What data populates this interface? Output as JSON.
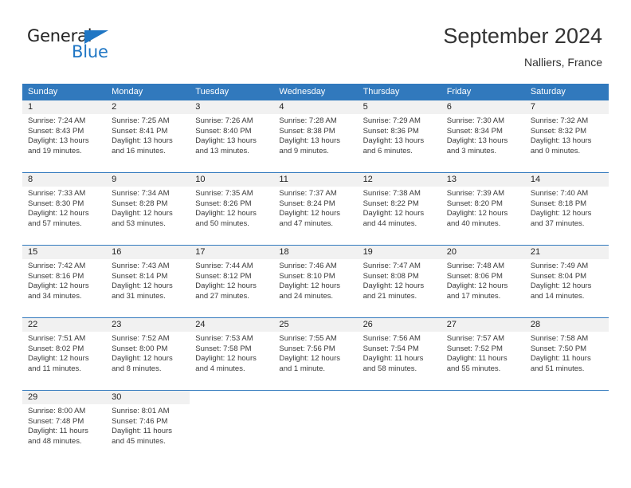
{
  "brand": {
    "name_part1": "General",
    "name_part2": "Blue",
    "triangle_color": "#1f76c4"
  },
  "header": {
    "title": "September 2024",
    "subtitle": "Nalliers, France"
  },
  "colors": {
    "header_blue": "#3179bd",
    "daynum_band": "#f1f1f1",
    "text": "#3a3a3a"
  },
  "weekday_headers": [
    "Sunday",
    "Monday",
    "Tuesday",
    "Wednesday",
    "Thursday",
    "Friday",
    "Saturday"
  ],
  "weeks": [
    [
      {
        "day": "1",
        "sunrise": "Sunrise: 7:24 AM",
        "sunset": "Sunset: 8:43 PM",
        "daylight1": "Daylight: 13 hours",
        "daylight2": "and 19 minutes."
      },
      {
        "day": "2",
        "sunrise": "Sunrise: 7:25 AM",
        "sunset": "Sunset: 8:41 PM",
        "daylight1": "Daylight: 13 hours",
        "daylight2": "and 16 minutes."
      },
      {
        "day": "3",
        "sunrise": "Sunrise: 7:26 AM",
        "sunset": "Sunset: 8:40 PM",
        "daylight1": "Daylight: 13 hours",
        "daylight2": "and 13 minutes."
      },
      {
        "day": "4",
        "sunrise": "Sunrise: 7:28 AM",
        "sunset": "Sunset: 8:38 PM",
        "daylight1": "Daylight: 13 hours",
        "daylight2": "and 9 minutes."
      },
      {
        "day": "5",
        "sunrise": "Sunrise: 7:29 AM",
        "sunset": "Sunset: 8:36 PM",
        "daylight1": "Daylight: 13 hours",
        "daylight2": "and 6 minutes."
      },
      {
        "day": "6",
        "sunrise": "Sunrise: 7:30 AM",
        "sunset": "Sunset: 8:34 PM",
        "daylight1": "Daylight: 13 hours",
        "daylight2": "and 3 minutes."
      },
      {
        "day": "7",
        "sunrise": "Sunrise: 7:32 AM",
        "sunset": "Sunset: 8:32 PM",
        "daylight1": "Daylight: 13 hours",
        "daylight2": "and 0 minutes."
      }
    ],
    [
      {
        "day": "8",
        "sunrise": "Sunrise: 7:33 AM",
        "sunset": "Sunset: 8:30 PM",
        "daylight1": "Daylight: 12 hours",
        "daylight2": "and 57 minutes."
      },
      {
        "day": "9",
        "sunrise": "Sunrise: 7:34 AM",
        "sunset": "Sunset: 8:28 PM",
        "daylight1": "Daylight: 12 hours",
        "daylight2": "and 53 minutes."
      },
      {
        "day": "10",
        "sunrise": "Sunrise: 7:35 AM",
        "sunset": "Sunset: 8:26 PM",
        "daylight1": "Daylight: 12 hours",
        "daylight2": "and 50 minutes."
      },
      {
        "day": "11",
        "sunrise": "Sunrise: 7:37 AM",
        "sunset": "Sunset: 8:24 PM",
        "daylight1": "Daylight: 12 hours",
        "daylight2": "and 47 minutes."
      },
      {
        "day": "12",
        "sunrise": "Sunrise: 7:38 AM",
        "sunset": "Sunset: 8:22 PM",
        "daylight1": "Daylight: 12 hours",
        "daylight2": "and 44 minutes."
      },
      {
        "day": "13",
        "sunrise": "Sunrise: 7:39 AM",
        "sunset": "Sunset: 8:20 PM",
        "daylight1": "Daylight: 12 hours",
        "daylight2": "and 40 minutes."
      },
      {
        "day": "14",
        "sunrise": "Sunrise: 7:40 AM",
        "sunset": "Sunset: 8:18 PM",
        "daylight1": "Daylight: 12 hours",
        "daylight2": "and 37 minutes."
      }
    ],
    [
      {
        "day": "15",
        "sunrise": "Sunrise: 7:42 AM",
        "sunset": "Sunset: 8:16 PM",
        "daylight1": "Daylight: 12 hours",
        "daylight2": "and 34 minutes."
      },
      {
        "day": "16",
        "sunrise": "Sunrise: 7:43 AM",
        "sunset": "Sunset: 8:14 PM",
        "daylight1": "Daylight: 12 hours",
        "daylight2": "and 31 minutes."
      },
      {
        "day": "17",
        "sunrise": "Sunrise: 7:44 AM",
        "sunset": "Sunset: 8:12 PM",
        "daylight1": "Daylight: 12 hours",
        "daylight2": "and 27 minutes."
      },
      {
        "day": "18",
        "sunrise": "Sunrise: 7:46 AM",
        "sunset": "Sunset: 8:10 PM",
        "daylight1": "Daylight: 12 hours",
        "daylight2": "and 24 minutes."
      },
      {
        "day": "19",
        "sunrise": "Sunrise: 7:47 AM",
        "sunset": "Sunset: 8:08 PM",
        "daylight1": "Daylight: 12 hours",
        "daylight2": "and 21 minutes."
      },
      {
        "day": "20",
        "sunrise": "Sunrise: 7:48 AM",
        "sunset": "Sunset: 8:06 PM",
        "daylight1": "Daylight: 12 hours",
        "daylight2": "and 17 minutes."
      },
      {
        "day": "21",
        "sunrise": "Sunrise: 7:49 AM",
        "sunset": "Sunset: 8:04 PM",
        "daylight1": "Daylight: 12 hours",
        "daylight2": "and 14 minutes."
      }
    ],
    [
      {
        "day": "22",
        "sunrise": "Sunrise: 7:51 AM",
        "sunset": "Sunset: 8:02 PM",
        "daylight1": "Daylight: 12 hours",
        "daylight2": "and 11 minutes."
      },
      {
        "day": "23",
        "sunrise": "Sunrise: 7:52 AM",
        "sunset": "Sunset: 8:00 PM",
        "daylight1": "Daylight: 12 hours",
        "daylight2": "and 8 minutes."
      },
      {
        "day": "24",
        "sunrise": "Sunrise: 7:53 AM",
        "sunset": "Sunset: 7:58 PM",
        "daylight1": "Daylight: 12 hours",
        "daylight2": "and 4 minutes."
      },
      {
        "day": "25",
        "sunrise": "Sunrise: 7:55 AM",
        "sunset": "Sunset: 7:56 PM",
        "daylight1": "Daylight: 12 hours",
        "daylight2": "and 1 minute."
      },
      {
        "day": "26",
        "sunrise": "Sunrise: 7:56 AM",
        "sunset": "Sunset: 7:54 PM",
        "daylight1": "Daylight: 11 hours",
        "daylight2": "and 58 minutes."
      },
      {
        "day": "27",
        "sunrise": "Sunrise: 7:57 AM",
        "sunset": "Sunset: 7:52 PM",
        "daylight1": "Daylight: 11 hours",
        "daylight2": "and 55 minutes."
      },
      {
        "day": "28",
        "sunrise": "Sunrise: 7:58 AM",
        "sunset": "Sunset: 7:50 PM",
        "daylight1": "Daylight: 11 hours",
        "daylight2": "and 51 minutes."
      }
    ],
    [
      {
        "day": "29",
        "sunrise": "Sunrise: 8:00 AM",
        "sunset": "Sunset: 7:48 PM",
        "daylight1": "Daylight: 11 hours",
        "daylight2": "and 48 minutes."
      },
      {
        "day": "30",
        "sunrise": "Sunrise: 8:01 AM",
        "sunset": "Sunset: 7:46 PM",
        "daylight1": "Daylight: 11 hours",
        "daylight2": "and 45 minutes."
      },
      {
        "day": "",
        "sunrise": "",
        "sunset": "",
        "daylight1": "",
        "daylight2": ""
      },
      {
        "day": "",
        "sunrise": "",
        "sunset": "",
        "daylight1": "",
        "daylight2": ""
      },
      {
        "day": "",
        "sunrise": "",
        "sunset": "",
        "daylight1": "",
        "daylight2": ""
      },
      {
        "day": "",
        "sunrise": "",
        "sunset": "",
        "daylight1": "",
        "daylight2": ""
      },
      {
        "day": "",
        "sunrise": "",
        "sunset": "",
        "daylight1": "",
        "daylight2": ""
      }
    ]
  ]
}
